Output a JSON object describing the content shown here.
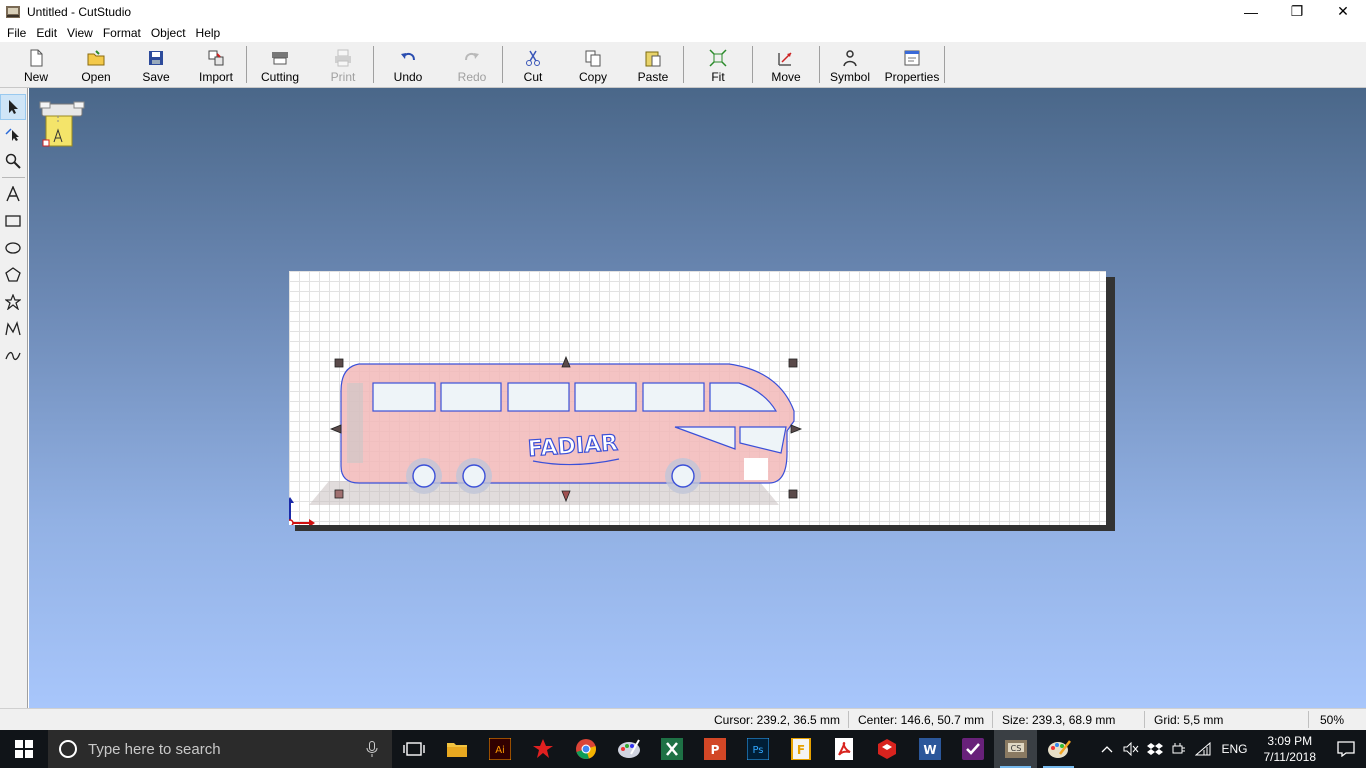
{
  "window": {
    "title": "Untitled - CutStudio",
    "buttons": {
      "minimize": "—",
      "restore": "❐",
      "close": "✕"
    }
  },
  "menu": [
    {
      "label": "File"
    },
    {
      "label": "Edit"
    },
    {
      "label": "View"
    },
    {
      "label": "Format"
    },
    {
      "label": "Object"
    },
    {
      "label": "Help"
    }
  ],
  "toolbar": {
    "new": "New",
    "open": "Open",
    "save": "Save",
    "import": "Import",
    "cutting": "Cutting",
    "print": "Print",
    "undo": "Undo",
    "redo": "Redo",
    "cut": "Cut",
    "copy": "Copy",
    "paste": "Paste",
    "fit": "Fit",
    "move": "Move",
    "symbol": "Symbol",
    "properties": "Properties"
  },
  "tools": [
    "select-tool",
    "node-edit-tool",
    "zoom-tool",
    "text-tool",
    "rectangle-tool",
    "ellipse-tool",
    "polygon-tool",
    "star-tool",
    "polyline-tool",
    "curve-tool"
  ],
  "status": {
    "cursor": "Cursor: 239.2, 36.5 mm",
    "center": "Center: 146.6, 50.7 mm",
    "size": "Size: 239.3, 68.9 mm",
    "grid": "Grid: 5,5 mm",
    "zoom": "50%"
  },
  "taskbar": {
    "search_placeholder": "Type here to search",
    "language": "ENG",
    "time": "3:09 PM",
    "date": "7/11/2018"
  },
  "artwork": {
    "logo_text": "FADIAR"
  },
  "colors": {
    "workspace_top": "#4a6789",
    "workspace_bottom": "#a8c6fb",
    "selection_fill": "#f2b8b8",
    "outline": "#3b50d8",
    "taskbar": "#101418"
  }
}
